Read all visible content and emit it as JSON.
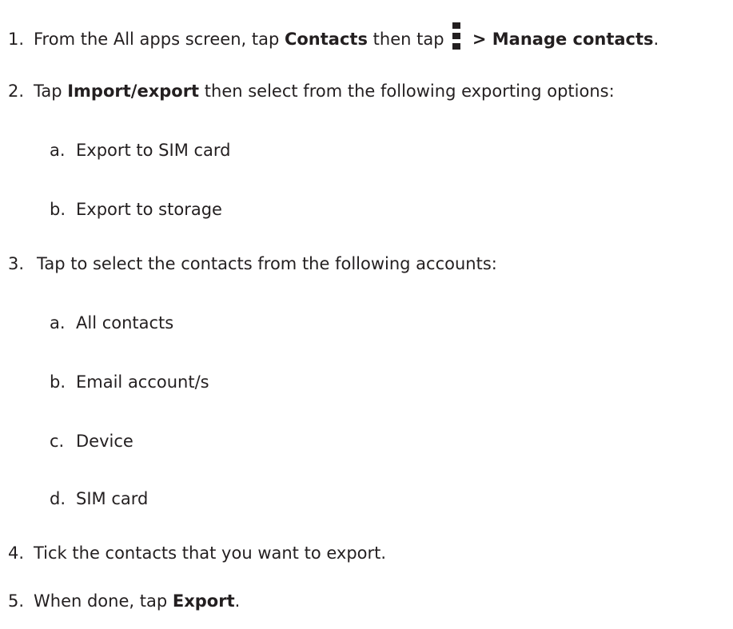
{
  "steps": [
    {
      "number": "1.",
      "text_before": "From the All apps screen, tap ",
      "bold_1": "Contacts",
      "text_middle": " then tap",
      "bold_2": " > Manage contacts",
      "text_after": ".",
      "icon": "overflow-menu-icon"
    },
    {
      "number": "2.",
      "text_before": "Tap ",
      "bold_1": "Import/export",
      "text_after": " then select from the following exporting options:",
      "options": [
        {
          "letter": "a.",
          "text": "Export to SIM card"
        },
        {
          "letter": "b.",
          "text": "Export to storage"
        }
      ]
    },
    {
      "number": "3.",
      "text": "Tap to select the contacts from the following accounts:",
      "options": [
        {
          "letter": "a.",
          "text": "All contacts"
        },
        {
          "letter": "b.",
          "text": "Email account/s"
        },
        {
          "letter": "c.",
          "text": "Device"
        },
        {
          "letter": "d.",
          "text": "SIM card"
        }
      ]
    },
    {
      "number": "4.",
      "text": "Tick the contacts that you want to export."
    },
    {
      "number": "5.",
      "text_before": "When done, tap ",
      "bold_1": "Export",
      "text_after": "."
    }
  ]
}
